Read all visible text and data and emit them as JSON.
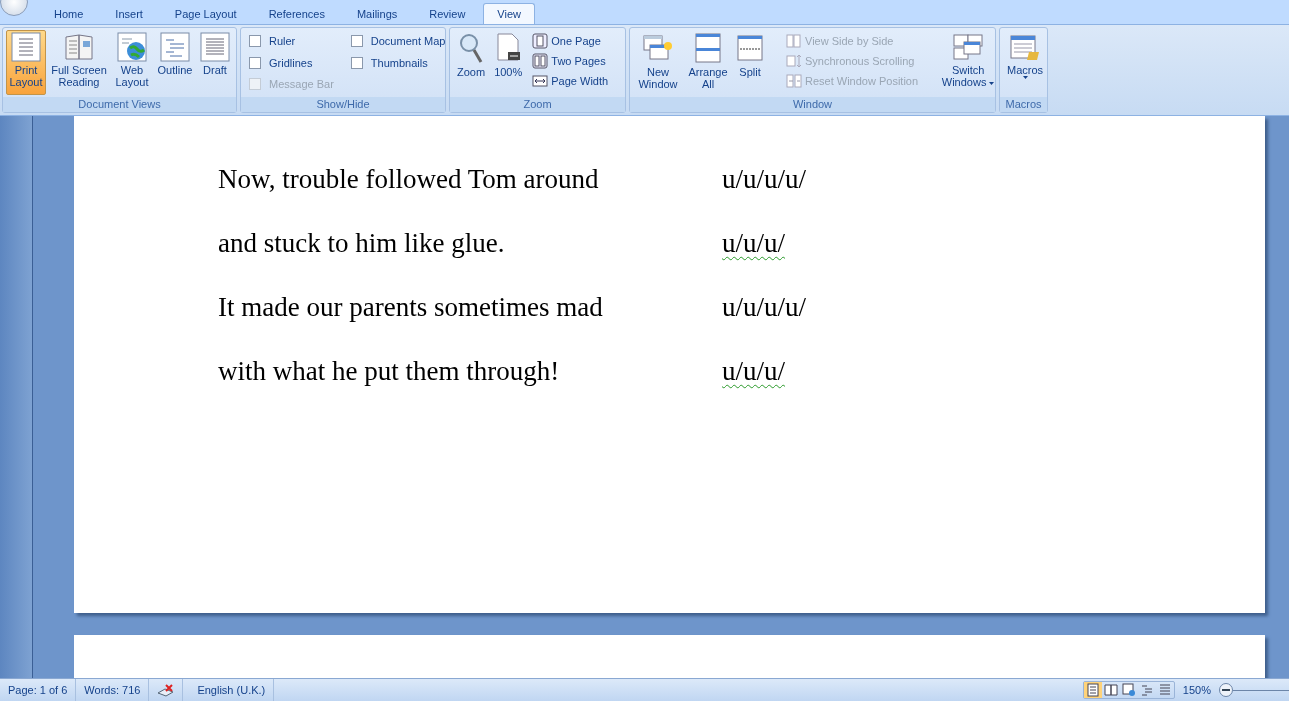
{
  "tabs": [
    {
      "label": "Home",
      "selected": false
    },
    {
      "label": "Insert",
      "selected": false
    },
    {
      "label": "Page Layout",
      "selected": false
    },
    {
      "label": "References",
      "selected": false
    },
    {
      "label": "Mailings",
      "selected": false
    },
    {
      "label": "Review",
      "selected": false
    },
    {
      "label": "View",
      "selected": true
    }
  ],
  "ribbon": {
    "document_views": {
      "title": "Document Views",
      "buttons": [
        {
          "kind": "print",
          "label": "Print Layout",
          "selected": true
        },
        {
          "kind": "fullscreen",
          "label": "Full Screen Reading",
          "selected": false
        },
        {
          "kind": "web",
          "label": "Web Layout",
          "selected": false
        },
        {
          "kind": "outline",
          "label": "Outline",
          "selected": false
        },
        {
          "kind": "draft",
          "label": "Draft",
          "selected": false
        }
      ]
    },
    "show_hide": {
      "title": "Show/Hide",
      "checkboxes": [
        {
          "label": "Ruler",
          "checked": false,
          "disabled": false
        },
        {
          "label": "Gridlines",
          "checked": false,
          "disabled": false
        },
        {
          "label": "Message Bar",
          "checked": false,
          "disabled": true
        },
        {
          "label": "Document Map",
          "checked": false,
          "disabled": false
        },
        {
          "label": "Thumbnails",
          "checked": false,
          "disabled": false
        }
      ]
    },
    "zoom": {
      "title": "Zoom",
      "large_buttons": [
        {
          "kind": "zoom",
          "label": "Zoom"
        },
        {
          "kind": "percent",
          "label": "100%"
        }
      ],
      "small_buttons": [
        {
          "kind": "one",
          "label": "One Page"
        },
        {
          "kind": "two",
          "label": "Two Pages"
        },
        {
          "kind": "width",
          "label": "Page Width"
        }
      ]
    },
    "window": {
      "title": "Window",
      "large_buttons": [
        {
          "kind": "new",
          "label": "New Window",
          "dropdown": false
        },
        {
          "kind": "arrange",
          "label": "Arrange All",
          "dropdown": false
        },
        {
          "kind": "split",
          "label": "Split",
          "dropdown": false
        }
      ],
      "small_buttons": [
        {
          "kind": "side",
          "label": "View Side by Side",
          "disabled": true
        },
        {
          "kind": "sync",
          "label": "Synchronous Scrolling",
          "disabled": true
        },
        {
          "kind": "reset",
          "label": "Reset Window Position",
          "disabled": true
        }
      ],
      "switch": {
        "label": "Switch Windows",
        "dropdown": true
      }
    },
    "macros": {
      "title": "Macros",
      "button": {
        "label": "Macros",
        "dropdown": true
      }
    }
  },
  "document": {
    "lines": [
      {
        "text": "Now, trouble followed Tom around",
        "scansion": "u/u/u/u/",
        "flagged": false
      },
      {
        "text": "and stuck to him like glue.",
        "scansion": "u/u/u/",
        "flagged": true
      },
      {
        "text": "It made our parents sometimes mad",
        "scansion": "u/u/u/u/",
        "flagged": false
      },
      {
        "text": "with what he put them through!",
        "scansion": "u/u/u/",
        "flagged": true
      }
    ]
  },
  "status_bar": {
    "page": "Page: 1 of 6",
    "words": "Words: 716",
    "language": "English (U.K.)",
    "view_buttons": [
      {
        "kind": "print",
        "selected": true
      },
      {
        "kind": "fullscreen",
        "selected": false
      },
      {
        "kind": "web",
        "selected": false
      },
      {
        "kind": "outline",
        "selected": false
      },
      {
        "kind": "draft",
        "selected": false
      }
    ],
    "zoom_level": "150%"
  }
}
